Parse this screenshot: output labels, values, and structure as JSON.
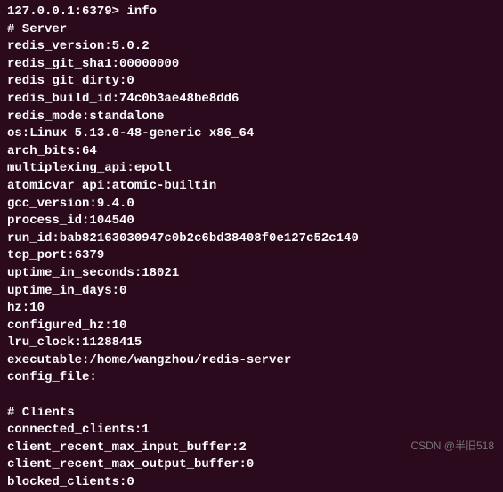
{
  "prompt": {
    "address": "127.0.0.1:6379>",
    "command": "info"
  },
  "sections": {
    "server": {
      "header": "# Server",
      "lines": [
        "redis_version:5.0.2",
        "redis_git_sha1:00000000",
        "redis_git_dirty:0",
        "redis_build_id:74c0b3ae48be8dd6",
        "redis_mode:standalone",
        "os:Linux 5.13.0-48-generic x86_64",
        "arch_bits:64",
        "multiplexing_api:epoll",
        "atomicvar_api:atomic-builtin",
        "gcc_version:9.4.0",
        "process_id:104540",
        "run_id:bab82163030947c0b2c6bd38408f0e127c52c140",
        "tcp_port:6379",
        "uptime_in_seconds:18021",
        "uptime_in_days:0",
        "hz:10",
        "configured_hz:10",
        "lru_clock:11288415",
        "executable:/home/wangzhou/redis-server",
        "config_file:"
      ]
    },
    "clients": {
      "header": "# Clients",
      "lines": [
        "connected_clients:1",
        "client_recent_max_input_buffer:2",
        "client_recent_max_output_buffer:0",
        "blocked_clients:0"
      ]
    }
  },
  "watermark": "CSDN @半旧518"
}
